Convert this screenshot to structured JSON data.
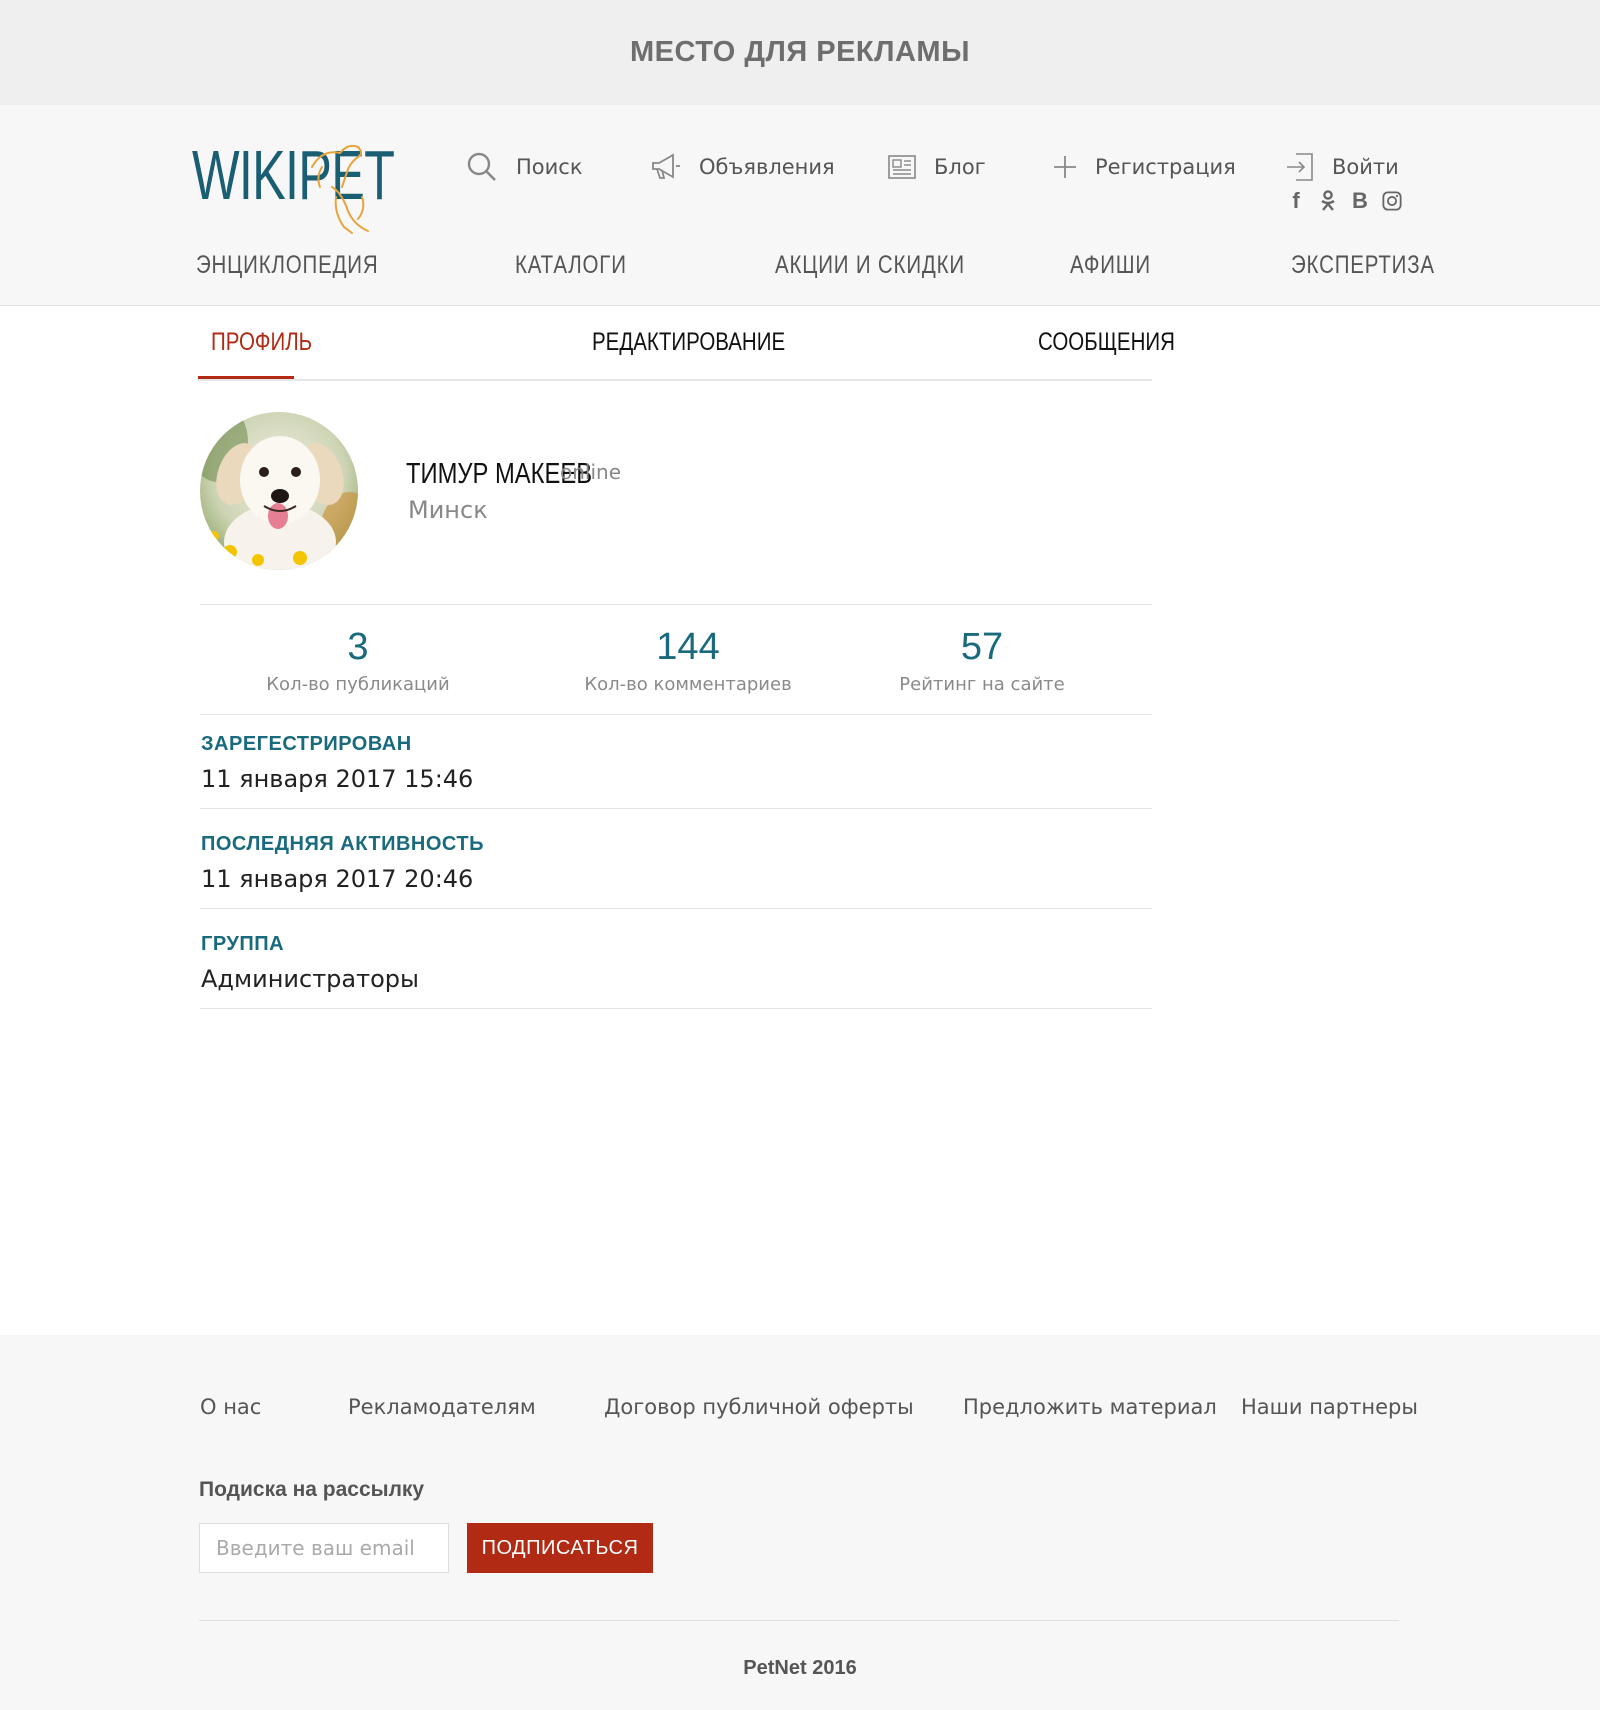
{
  "ad_bar": {
    "text": "МЕСТО ДЛЯ РЕКЛАМЫ"
  },
  "header": {
    "logo_text": "WIKIPET",
    "top_nav": [
      {
        "label": "Поиск",
        "icon": "search-icon"
      },
      {
        "label": "Объявления",
        "icon": "megaphone-icon"
      },
      {
        "label": "Блог",
        "icon": "newspaper-icon"
      },
      {
        "label": "Регистрация",
        "icon": "plus-icon"
      },
      {
        "label": "Войти",
        "icon": "login-icon"
      }
    ],
    "socials": [
      {
        "label": "f",
        "icon": "facebook-icon"
      },
      {
        "label": "ok",
        "icon": "odnoklassniki-icon"
      },
      {
        "label": "B",
        "icon": "vkontakte-icon"
      },
      {
        "label": "",
        "icon": "instagram-icon"
      }
    ],
    "main_nav": [
      "ЭНЦИКЛОПЕДИЯ",
      "КАТАЛОГИ",
      "АКЦИИ И СКИДКИ",
      "АФИШИ",
      "ЭКСПЕРТИЗА"
    ]
  },
  "tabs": [
    {
      "label": "ПРОФИЛЬ",
      "active": true
    },
    {
      "label": "РЕДАКТИРОВАНИЕ",
      "active": false
    },
    {
      "label": "СООБЩЕНИЯ",
      "active": false
    }
  ],
  "profile": {
    "name": "ТИМУР МАКЕЕВ",
    "status": "online",
    "city": "Минск"
  },
  "stats": [
    {
      "value": "3",
      "label": "Кол-во публикаций"
    },
    {
      "value": "144",
      "label": "Кол-во комментариев"
    },
    {
      "value": "57",
      "label": "Рейтинг на сайте"
    }
  ],
  "info": [
    {
      "label": "ЗАРЕГЕСТРИРОВАН",
      "value": "11 января 2017 15:46"
    },
    {
      "label": "ПОСЛЕДНЯЯ АКТИВНОСТЬ",
      "value": "11 января 2017 20:46"
    },
    {
      "label": "ГРУППА",
      "value": "Администраторы"
    }
  ],
  "footer": {
    "links": [
      "О нас",
      "Рекламодателям",
      "Договор публичной оферты",
      "Предложить материал",
      "Наши партнеры"
    ],
    "subscribe_title": "Подиска на рассылку",
    "email_placeholder": "Введите ваш email",
    "subscribe_button": "ПОДПИСАТЬСЯ",
    "copyright": "PetNet 2016"
  },
  "colors": {
    "accent_red": "#b02a14",
    "accent_teal": "#1a6a7e",
    "logo_orange": "#e8a33b"
  }
}
